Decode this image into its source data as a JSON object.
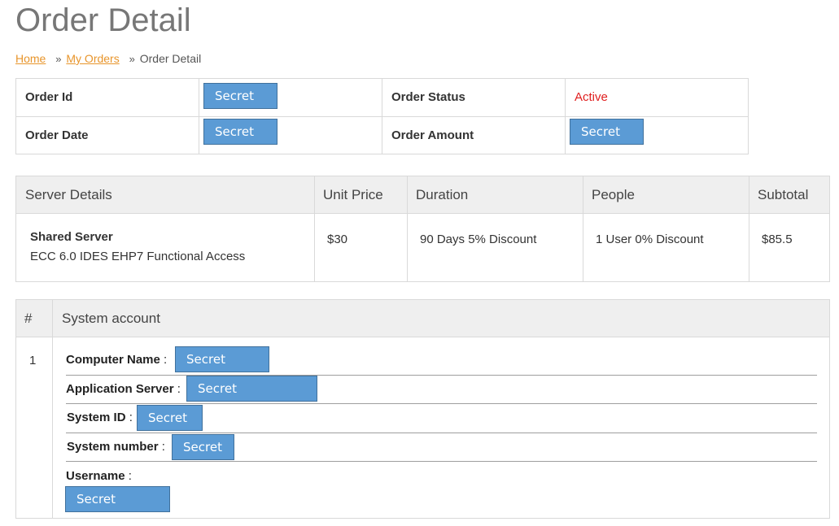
{
  "page": {
    "title": "Order Detail"
  },
  "breadcrumb": {
    "home": "Home",
    "sep": "»",
    "my_orders": "My Orders",
    "current": "Order Detail"
  },
  "order_info": {
    "order_id_label": "Order Id",
    "order_id_value": "Secret",
    "order_status_label": "Order Status",
    "order_status_value": "Active",
    "order_date_label": "Order Date",
    "order_date_value": "Secret",
    "order_amount_label": "Order Amount",
    "order_amount_value": "Secret"
  },
  "server_details": {
    "headers": [
      "Server Details",
      "Unit Price",
      "Duration",
      "People",
      "Subtotal"
    ],
    "row": {
      "server_name": "Shared Server",
      "server_desc": "ECC 6.0 IDES EHP7 Functional Access",
      "unit_price": "$30",
      "duration": "90 Days 5% Discount",
      "people": "1 User 0% Discount",
      "subtotal": "$85.5"
    }
  },
  "system_account": {
    "headers": [
      "#",
      "System account"
    ],
    "row_number": "1",
    "fields": [
      {
        "label": "Computer Name",
        "value": "Secret"
      },
      {
        "label": "Application Server",
        "value": "Secret"
      },
      {
        "label": "System ID",
        "value": "Secret"
      },
      {
        "label": "System number",
        "value": "Secret"
      },
      {
        "label": "Username",
        "value": "Secret"
      }
    ],
    "colon": ":"
  },
  "colors": {
    "link": "#e8952b",
    "status_active": "#e02020",
    "redaction_fill": "#5b9bd5",
    "redaction_border": "#41719c",
    "header_bg": "#efefef"
  }
}
